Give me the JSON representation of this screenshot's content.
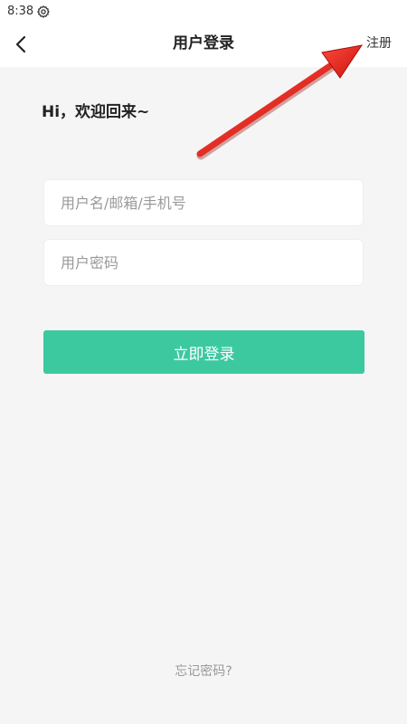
{
  "status_bar": {
    "time": "8:38",
    "icons": [
      "gear-icon"
    ]
  },
  "nav": {
    "title": "用户登录",
    "back_icon": "chevron-left-icon",
    "register_label": "注册"
  },
  "greeting": "Hi，欢迎回来~",
  "form": {
    "username_value": "",
    "username_placeholder": "用户名/邮箱/手机号",
    "password_value": "",
    "password_placeholder": "用户密码",
    "login_label": "立即登录"
  },
  "forgot_password_label": "忘记密码?",
  "colors": {
    "accent": "#3cc9a0",
    "background": "#f5f5f5",
    "annotation_arrow": "#e3201b"
  }
}
